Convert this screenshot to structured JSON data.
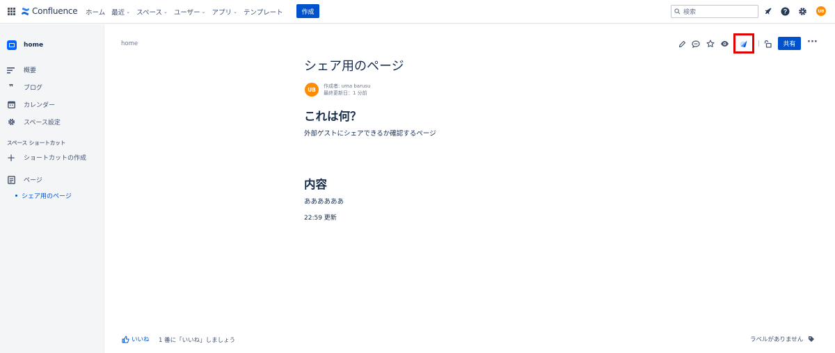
{
  "topnav": {
    "product": "Confluence",
    "items": [
      {
        "label": "ホーム",
        "dropdown": false
      },
      {
        "label": "最近",
        "dropdown": true
      },
      {
        "label": "スペース",
        "dropdown": true
      },
      {
        "label": "ユーザー",
        "dropdown": true
      },
      {
        "label": "アプリ",
        "dropdown": true
      },
      {
        "label": "テンプレート",
        "dropdown": false
      }
    ],
    "create_label": "作成",
    "search_placeholder": "検索",
    "avatar_initials": "UB",
    "icons": [
      "notifications-icon",
      "help-icon",
      "settings-icon"
    ]
  },
  "sidebar": {
    "space_name": "home",
    "items": [
      {
        "label": "概要",
        "icon": "overview-icon"
      },
      {
        "label": "ブログ",
        "icon": "blog-icon"
      },
      {
        "label": "カレンダー",
        "icon": "calendar-icon"
      },
      {
        "label": "スペース設定",
        "icon": "settings-icon"
      }
    ],
    "shortcut_section": "スペース ショートカット",
    "shortcut_create": "ショートカットの作成",
    "pages_label": "ページ",
    "page_child": "シェア用のページ"
  },
  "page": {
    "breadcrumb": "home",
    "title": "シェア用のページ",
    "author_initials": "UB",
    "author_line": "作成者: uma barusu",
    "updated_line": "最終更新日：1 分前",
    "section1_heading": "これは何？",
    "section1_text": "外部ゲストにシェアできるか確認するページ",
    "section2_heading": "内容",
    "section2_text": "ああああああ",
    "update_note": "22:59 更新"
  },
  "toolbar": {
    "share_label": "共有",
    "icons": [
      "edit-icon",
      "comment-icon",
      "star-icon",
      "watch-icon",
      "share-link-icon",
      "restrictions-icon",
      "more-icon"
    ]
  },
  "footer": {
    "like_label": "いいね",
    "like_prompt": "1 番に「いいね」しましょう",
    "labels_text": "ラベルがありません"
  },
  "colors": {
    "brand": "#0052cc",
    "avatar": "#ff8b00",
    "highlight": "#e00000"
  }
}
